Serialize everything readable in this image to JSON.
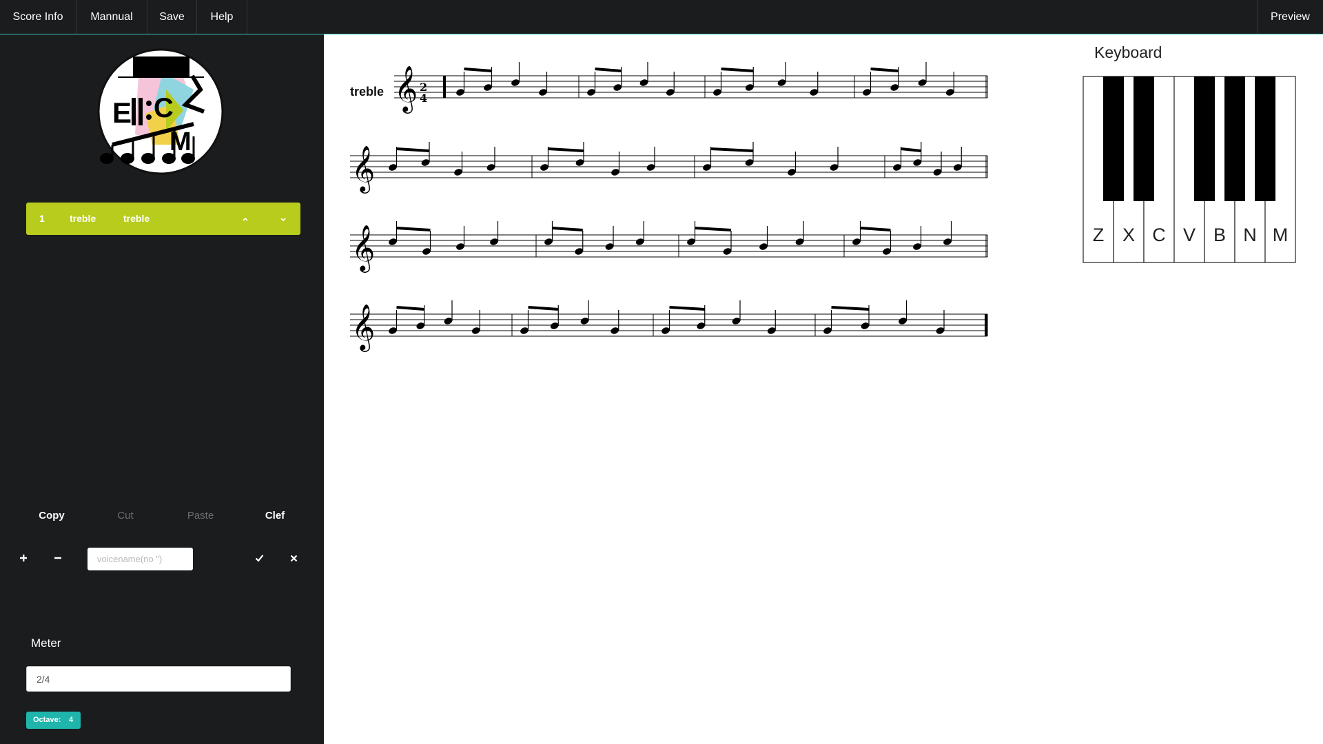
{
  "topbar": {
    "menu": [
      "Score Info",
      "Mannual",
      "Save",
      "Help"
    ],
    "preview_label": "Preview"
  },
  "sidebar": {
    "voice": {
      "index": "1",
      "name": "treble",
      "clef": "treble",
      "up_icon": "chevron-up-icon",
      "down_icon": "chevron-down-icon"
    },
    "edit": {
      "copy": "Copy",
      "cut": "Cut",
      "paste": "Paste",
      "clef": "Clef"
    },
    "voice_controls": {
      "add_icon": "plus-icon",
      "remove_icon": "minus-icon",
      "input_placeholder": "voicename(no \")",
      "confirm_icon": "check-icon",
      "cancel_icon": "close-icon"
    },
    "meter_label": "Meter",
    "meter_value": "2/4",
    "octave_label": "Octave:",
    "octave_value": "4"
  },
  "score": {
    "voice_label": "treble",
    "time_signature": {
      "top": "2",
      "bottom": "4"
    },
    "clef": "treble"
  },
  "keyboard": {
    "title": "Keyboard",
    "white_keys": [
      "Z",
      "X",
      "C",
      "V",
      "B",
      "N",
      "M"
    ]
  },
  "colors": {
    "accent_teal": "#3fc7c0",
    "voice_green": "#b7cc1c",
    "octave_teal": "#1fb5ad",
    "dark_bg": "#1b1c1e"
  }
}
